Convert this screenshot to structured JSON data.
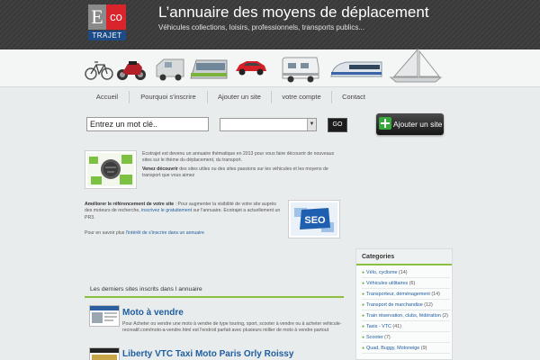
{
  "header": {
    "logo_e": "E",
    "logo_co": "co",
    "logo_trajet": "TRAJET",
    "title": "L’annuaire des moyens de déplacement",
    "tagline": "Véhicules collections, loisirs, professionnels, transports publics..."
  },
  "vehicles": [
    "bicycle-icon",
    "motorcycle-icon",
    "van-icon",
    "tram-icon",
    "sports-car-icon",
    "camper-icon",
    "train-icon",
    "sailboat-icon"
  ],
  "nav": {
    "items": [
      {
        "label": "Accueil"
      },
      {
        "label": "Pourquoi s'inscrire"
      },
      {
        "label": "Ajouter un site"
      },
      {
        "label": "votre compte"
      },
      {
        "label": "Contact"
      }
    ]
  },
  "search": {
    "input_value": "Entrez un mot clé..",
    "select_value": "",
    "go_label": "GO",
    "add_site_label": "Ajouter un site"
  },
  "intro": {
    "p1": "Ecotrajet est devenu un annuaire thématique en 2013 pour vous faire découvrir de nouveaux sites sur le thème du déplacement, du transport.",
    "p2_bold": "Venez découvrir",
    "p2_rest": " des sites utiles ou des sites passions sur les véhicules et les moyens de transport que vous aimez",
    "p3_bold": "Améliorer le référencement de votre site",
    "p3_rest": " : Pour augmenter la visibilité de votre site auprès des moteurs de recherche, ",
    "p3_link": "inscrivez le gratuitement",
    "p3_end": " sur l'annuaire. Ecotrajet a actuellement un PR3.",
    "p4_start": "Pour en savoir plus ",
    "p4_link": "l'intérêt de s'inscrire dans un annuaire",
    "seo_label": "SEO"
  },
  "latest": {
    "header": "Les derniers sites inscrits dans l annuaire",
    "sites": [
      {
        "title": "Moto à vendre",
        "desc": "Pour Acheter ou vendre une moto à vendre de type touring, sport, scooter à vendre ou à acheter vehicule-recreatif.com/moto-a-vendre.html est l'endroit parfait avec plusieurs millier de moto à vendre partout"
      },
      {
        "title": "Liberty VTC Taxi Moto Paris Orly Roissy",
        "desc": ""
      }
    ]
  },
  "categories": {
    "header": "Categories",
    "items": [
      {
        "name": "Vélo, cyclisme",
        "count": "(14)"
      },
      {
        "name": "Véhicules utilitaires",
        "count": "(6)"
      },
      {
        "name": "Transporteur, déménagement",
        "count": "(14)"
      },
      {
        "name": "Transport de marchandise",
        "count": "(12)"
      },
      {
        "name": "Train réservation, clubs, fédération",
        "count": "(2)"
      },
      {
        "name": "Taxis - VTC",
        "count": "(41)"
      },
      {
        "name": "Scooter",
        "count": "(7)"
      },
      {
        "name": "Quad, Buggy, Motoneige",
        "count": "(9)"
      }
    ]
  },
  "colors": {
    "accent_green": "#8cbf3f",
    "link_blue": "#1f5ea0",
    "logo_red": "#d8242a",
    "logo_blue": "#1c4b88"
  }
}
